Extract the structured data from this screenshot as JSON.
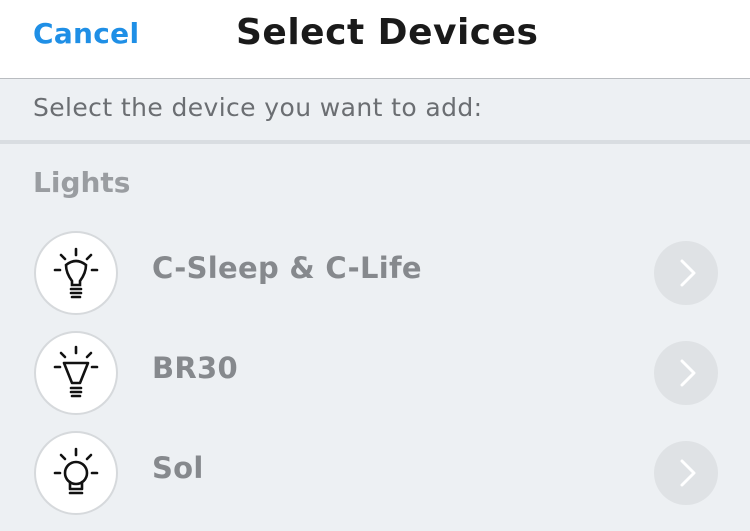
{
  "navbar": {
    "cancel_label": "Cancel",
    "title": "Select Devices"
  },
  "instruction": "Select the device you want to add:",
  "section": {
    "header": "Lights",
    "devices": [
      {
        "label": "C-Sleep & C-Life",
        "icon": "lightbulb-icon"
      },
      {
        "label": "BR30",
        "icon": "flood-bulb-icon"
      },
      {
        "label": "Sol",
        "icon": "globe-bulb-icon"
      }
    ]
  },
  "colors": {
    "accent": "#1f8fe6",
    "background": "#edf0f3",
    "label": "#86898d"
  }
}
